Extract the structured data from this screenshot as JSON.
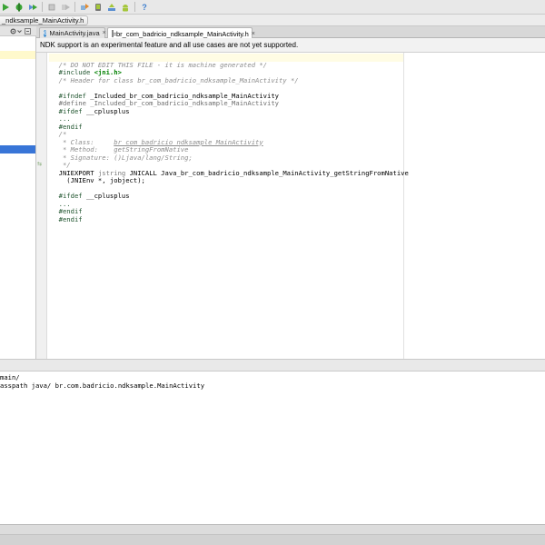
{
  "breadcrumb": {
    "label": "_ndksample_MainActivity.h"
  },
  "tabs": [
    {
      "label": "MainActivity.java",
      "close": "×"
    },
    {
      "label": "br_com_badricio_ndksample_MainActivity.h",
      "close": "×"
    }
  ],
  "notification": {
    "text": "NDK support is an experimental feature and all use cases are not yet supported."
  },
  "code": {
    "l1": "/* DO NOT EDIT THIS FILE - it is machine generated */",
    "l2_dir": "#include ",
    "l2_arg": "<jni.h>",
    "l3": "/* Header for class br_com_badricio_ndksample_MainActivity */",
    "l5_dir": "#ifndef ",
    "l5_arg": "_Included_br_com_badricio_ndksample_MainActivity",
    "l6": "#define _Included_br_com_badricio_ndksample_MainActivity",
    "l7_dir": "#ifdef ",
    "l7_arg": "__cplusplus",
    "l8": "...",
    "l9": "#endif",
    "l10": "/*",
    "l11_a": " * Class:     ",
    "l11_b": "br_com_badricio_ndksample_MainActivity",
    "l12": " * Method:    getStringFromNative",
    "l13": " * Signature: ()Ljava/lang/String;",
    "l14": " */",
    "l15_a": "JNIEXPORT ",
    "l15_b": "jstring ",
    "l15_c": "JNICALL Java_br_com_badricio_ndksample_MainActivity_getStringFromNative",
    "l16": "  (JNIEnv *, jobject);",
    "l18_dir": "#ifdef ",
    "l18_arg": "__cplusplus",
    "l19": "...",
    "l20": "#endif",
    "l21": "#endif"
  },
  "gutter_mark": "⇆",
  "help_icon": "?",
  "console": {
    "line1": "main/",
    "line2": "asspath java/ br.com.badricio.ndksample.MainActivity"
  },
  "colors": {
    "selection": "#3875d7",
    "highlight_row": "#fffce4",
    "directive": "#1f542e",
    "comment": "#8c8c8c"
  }
}
